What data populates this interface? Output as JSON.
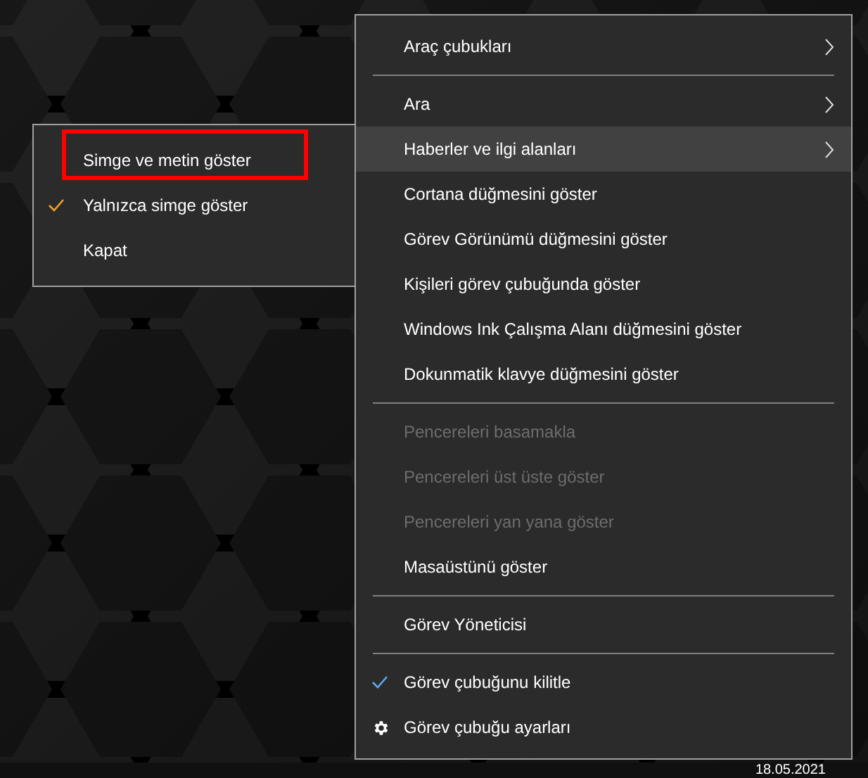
{
  "submenu": {
    "items": [
      {
        "label": "Simge ve metin göster",
        "checked": false,
        "annotated": true
      },
      {
        "label": "Yalnızca simge göster",
        "checked": true,
        "annotated": false
      },
      {
        "label": "Kapat",
        "checked": false,
        "annotated": false
      }
    ]
  },
  "context_menu": {
    "items": [
      {
        "kind": "submenu",
        "label": "Araç çubukları",
        "selected": false,
        "disabled": false
      },
      {
        "kind": "separator"
      },
      {
        "kind": "submenu",
        "label": "Ara",
        "selected": false,
        "disabled": false
      },
      {
        "kind": "submenu",
        "label": "Haberler ve ilgi alanları",
        "selected": true,
        "disabled": false
      },
      {
        "kind": "command",
        "label": "Cortana düğmesini göster",
        "selected": false,
        "disabled": false
      },
      {
        "kind": "command",
        "label": "Görev Görünümü düğmesini göster",
        "selected": false,
        "disabled": false
      },
      {
        "kind": "command",
        "label": "Kişileri görev çubuğunda göster",
        "selected": false,
        "disabled": false
      },
      {
        "kind": "command",
        "label": "Windows Ink Çalışma Alanı düğmesini göster",
        "selected": false,
        "disabled": false
      },
      {
        "kind": "command",
        "label": "Dokunmatik klavye düğmesini göster",
        "selected": false,
        "disabled": false
      },
      {
        "kind": "separator"
      },
      {
        "kind": "command",
        "label": "Pencereleri basamakla",
        "selected": false,
        "disabled": true
      },
      {
        "kind": "command",
        "label": "Pencereleri üst üste göster",
        "selected": false,
        "disabled": true
      },
      {
        "kind": "command",
        "label": "Pencereleri yan yana göster",
        "selected": false,
        "disabled": true
      },
      {
        "kind": "command",
        "label": "Masaüstünü göster",
        "selected": false,
        "disabled": false
      },
      {
        "kind": "separator"
      },
      {
        "kind": "command",
        "label": "Görev Yöneticisi",
        "selected": false,
        "disabled": false
      },
      {
        "kind": "separator"
      },
      {
        "kind": "check",
        "label": "Görev çubuğunu kilitle",
        "selected": false,
        "disabled": false,
        "checked": true
      },
      {
        "kind": "settings",
        "label": "Görev çubuğu ayarları",
        "selected": false,
        "disabled": false
      }
    ]
  },
  "taskbar": {
    "date": "18.05.2021"
  }
}
